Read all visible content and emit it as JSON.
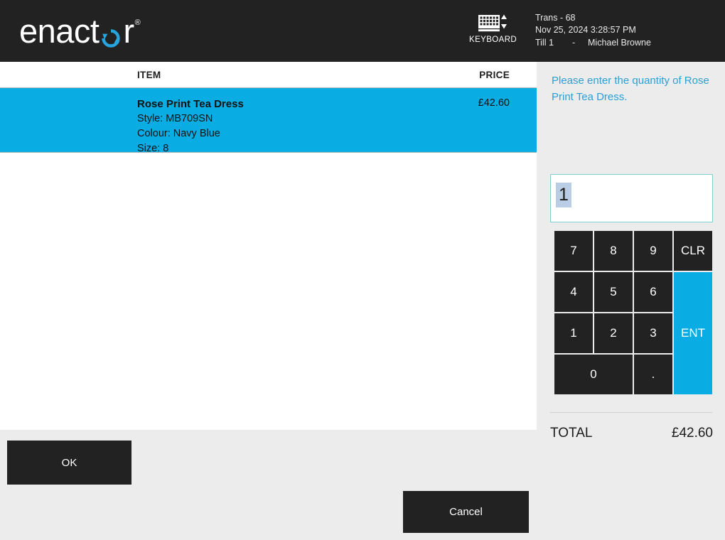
{
  "header": {
    "logo_before": "enact",
    "logo_icon": "refresh-circle-o",
    "logo_after": "r",
    "logo_reg": "®",
    "keyboard": {
      "icon": "keyboard-icon",
      "label": "KEYBOARD"
    },
    "transaction": {
      "trans": "Trans - 68",
      "datetime": "Nov 25, 2024 3:28:57 PM",
      "till": "Till 1",
      "separator": "-",
      "operator": "Michael Browne"
    }
  },
  "basket": {
    "columns": {
      "item": "ITEM",
      "price": "PRICE"
    },
    "rows": [
      {
        "name": "Rose Print Tea Dress",
        "style": "Style: MB709SN",
        "colour": "Colour: Navy Blue",
        "size": "Size: 8",
        "price": "£42.60",
        "selected": true
      }
    ]
  },
  "side": {
    "prompt": "Please enter the quantity of Rose Print Tea Dress.",
    "input": {
      "value": "1",
      "selected": true
    },
    "keypad": {
      "k7": "7",
      "k8": "8",
      "k9": "9",
      "clr": "CLR",
      "k4": "4",
      "k5": "5",
      "k6": "6",
      "k1": "1",
      "k2": "2",
      "k3": "3",
      "ent": "ENT",
      "k0": "0",
      "dot": "."
    },
    "total": {
      "label": "TOTAL",
      "value": "£42.60"
    }
  },
  "footer": {
    "ok": "OK",
    "cancel": "Cancel"
  },
  "colors": {
    "accent": "#09ADE3",
    "dark": "#222222",
    "panel": "#ececec",
    "prompt_text": "#2c9fd4",
    "selection": "#b9cde4"
  }
}
